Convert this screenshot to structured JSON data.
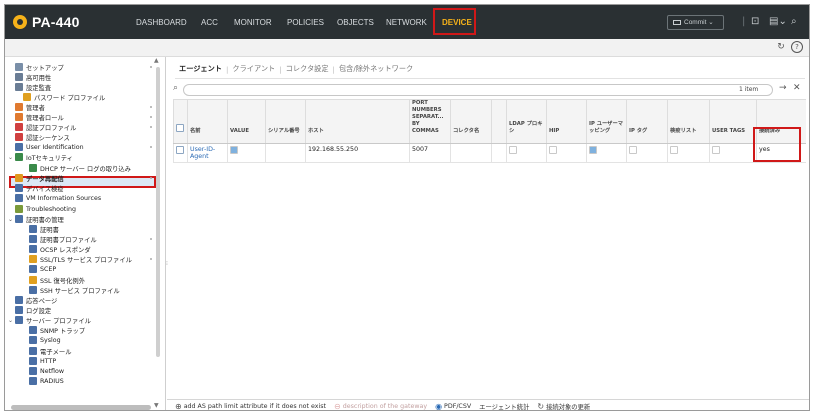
{
  "app": {
    "name": "PA-440"
  },
  "nav": [
    {
      "label": "DASHBOARD"
    },
    {
      "label": "ACC"
    },
    {
      "label": "MONITOR"
    },
    {
      "label": "POLICIES"
    },
    {
      "label": "OBJECTS"
    },
    {
      "label": "NETWORK"
    },
    {
      "label": "DEVICE"
    }
  ],
  "commit": {
    "label": "Commit"
  },
  "sidebar": {
    "items": [
      {
        "label": "セットアップ",
        "icon": "setup-icon",
        "color": "#7a8fa8"
      },
      {
        "label": "高可用性",
        "icon": "ha-icon",
        "color": "#6a7d95"
      },
      {
        "label": "設定監査",
        "icon": "audit-icon",
        "color": "#6a7d95"
      },
      {
        "label": "パスワード プロファイル",
        "icon": "password-icon",
        "color": "#e0a020"
      },
      {
        "label": "管理者",
        "icon": "admin-icon",
        "color": "#e07a30"
      },
      {
        "label": "管理者ロール",
        "icon": "admin-role-icon",
        "color": "#e07a30"
      },
      {
        "label": "認証プロファイル",
        "icon": "auth-profile-icon",
        "color": "#d04040"
      },
      {
        "label": "認証シーケンス",
        "icon": "auth-sequence-icon",
        "color": "#d04040"
      },
      {
        "label": "User Identification",
        "icon": "user-id-icon",
        "color": "#4a6fa5"
      },
      {
        "label": "IoTセキュリティ",
        "icon": "iot-icon",
        "color": "#3a8a4a"
      },
      {
        "label": "DHCP サーバー ログの取り込み",
        "icon": "dhcp-icon",
        "color": "#3a8a4a"
      },
      {
        "label": "データ再配信",
        "icon": "redistribution-icon",
        "color": "#e09a20"
      },
      {
        "label": "デバイス検疫",
        "icon": "quarantine-icon",
        "color": "#4a6fa5"
      },
      {
        "label": "VM Information Sources",
        "icon": "vm-icon",
        "color": "#4a6fa5"
      },
      {
        "label": "Troubleshooting",
        "icon": "troubleshooting-icon",
        "color": "#7a9a3a"
      },
      {
        "label": "証明書の管理",
        "icon": "cert-mgmt-icon",
        "color": "#4a6fa5"
      },
      {
        "label": "証明書",
        "icon": "certificate-icon",
        "color": "#4a6fa5"
      },
      {
        "label": "証明書プロファイル",
        "icon": "cert-profile-icon",
        "color": "#4a6fa5"
      },
      {
        "label": "OCSP レスポンダ",
        "icon": "ocsp-icon",
        "color": "#4a6fa5"
      },
      {
        "label": "SSL/TLS サービス プロファイル",
        "icon": "ssl-profile-icon",
        "color": "#e0a020"
      },
      {
        "label": "SCEP",
        "icon": "scep-icon",
        "color": "#4a6fa5"
      },
      {
        "label": "SSL 復号化例外",
        "icon": "ssl-exclusion-icon",
        "color": "#e0a020"
      },
      {
        "label": "SSH サービス プロファイル",
        "icon": "ssh-profile-icon",
        "color": "#4a6fa5"
      },
      {
        "label": "応答ページ",
        "icon": "response-page-icon",
        "color": "#4a6fa5"
      },
      {
        "label": "ログ設定",
        "icon": "log-settings-icon",
        "color": "#4a6fa5"
      },
      {
        "label": "サーバー プロファイル",
        "icon": "server-profile-icon",
        "color": "#4a6fa5"
      },
      {
        "label": "SNMP トラップ",
        "icon": "snmp-icon",
        "color": "#4a6fa5"
      },
      {
        "label": "Syslog",
        "icon": "syslog-icon",
        "color": "#4a6fa5"
      },
      {
        "label": "電子メール",
        "icon": "email-icon",
        "color": "#4a6fa5"
      },
      {
        "label": "HTTP",
        "icon": "http-icon",
        "color": "#4a6fa5"
      },
      {
        "label": "Netflow",
        "icon": "netflow-icon",
        "color": "#4a6fa5"
      },
      {
        "label": "RADIUS",
        "icon": "radius-icon",
        "color": "#4a6fa5"
      }
    ]
  },
  "tabs": [
    {
      "label": "エージェント"
    },
    {
      "label": "クライアント"
    },
    {
      "label": "コレクタ設定"
    },
    {
      "label": "包含/除外ネットワーク"
    }
  ],
  "filter": {
    "count": "1 item"
  },
  "table": {
    "headers": {
      "name": "名前",
      "value": "VALUE",
      "serial": "シリアル番号",
      "host": "ホスト",
      "port": "PORT NUMBERS SEPARAT... BY COMMAS",
      "collector": "コレクタ名",
      "ldap": "LDAP プロキシ",
      "hip": "HIP",
      "ipuser": "IP ユーザーマッピング",
      "iptag": "IP タグ",
      "quarantine": "検疫リスト",
      "usertags": "USER TAGS",
      "connected": "接続済み"
    },
    "rows": [
      {
        "name": "User-ID-Agent",
        "value_checked": true,
        "serial": "",
        "host": "192.168.55.250",
        "port": "5007",
        "collector": "",
        "ldap_checked": false,
        "hip_checked": false,
        "ipuser_checked": true,
        "iptag_checked": false,
        "quarantine_checked": false,
        "usertags_checked": false,
        "connected": "yes"
      }
    ]
  },
  "bottombar": {
    "add": "add AS path limit attribute if it does not exist",
    "gateway": "description of the gateway",
    "pdf": "PDF/CSV",
    "stats": "エージェント統計",
    "refresh": "接続対象の更新"
  }
}
